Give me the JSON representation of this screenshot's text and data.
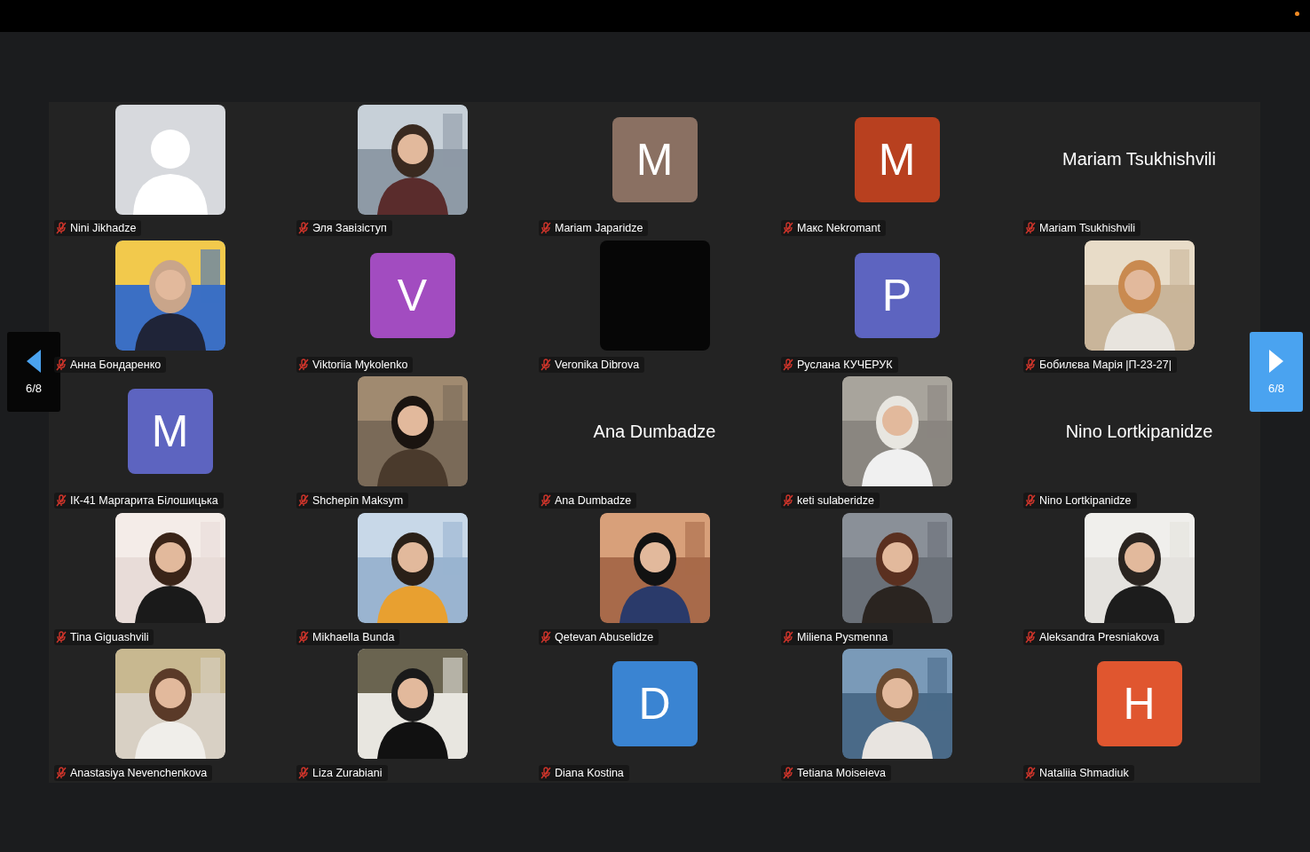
{
  "pager": {
    "previous": "6/8",
    "next": "6/8"
  },
  "participants": [
    {
      "name": "Nini Jikhadze",
      "muted": true,
      "tile": {
        "kind": "silhouette"
      }
    },
    {
      "name": "Эля Завізіступ",
      "muted": true
    },
    {
      "name": "Mariam Japaridze",
      "muted": true,
      "tile": {
        "kind": "initial",
        "letter": "M",
        "color": "#8a7062"
      }
    },
    {
      "name": "Макс Nekromant",
      "muted": true,
      "tile": {
        "kind": "initial",
        "letter": "M",
        "color": "#b8401f"
      }
    },
    {
      "name": "Mariam Tsukhishvili",
      "muted": true,
      "tile": {
        "kind": "name",
        "text": "Mariam Tsukhishvili"
      }
    },
    {
      "name": "Анна Бондаренко",
      "muted": true
    },
    {
      "name": "Viktoriia Mykolenko",
      "muted": true,
      "tile": {
        "kind": "initial",
        "letter": "V",
        "color": "#a24cc0"
      }
    },
    {
      "name": "Veronika Dibrova",
      "muted": true,
      "tile": {
        "kind": "blank"
      }
    },
    {
      "name": "Руслана КУЧЕРУК",
      "muted": true,
      "tile": {
        "kind": "initial",
        "letter": "P",
        "color": "#5d64c0"
      }
    },
    {
      "name": "Бобилєва Марія |П-23-27|",
      "muted": true
    },
    {
      "name": "ІК-41 Маргарита Білошицька",
      "muted": true,
      "tile": {
        "kind": "initial",
        "letter": "M",
        "color": "#5d64c0"
      }
    },
    {
      "name": "Shchepin Maksym",
      "muted": true
    },
    {
      "name": "Ana Dumbadze",
      "muted": true,
      "tile": {
        "kind": "name",
        "text": "Ana Dumbadze"
      }
    },
    {
      "name": "keti sulaberidze",
      "muted": true
    },
    {
      "name": "Nino Lortkipanidze",
      "muted": true,
      "tile": {
        "kind": "name",
        "text": "Nino Lortkipanidze"
      }
    },
    {
      "name": "Tina Giguashvili",
      "muted": true
    },
    {
      "name": "Mikhaella Bunda",
      "muted": true
    },
    {
      "name": "Qetevan Abuselidze",
      "muted": true
    },
    {
      "name": "Miliena Pysmenna",
      "muted": true
    },
    {
      "name": "Aleksandra Presniakova",
      "muted": true
    },
    {
      "name": "Anastasiya Nevenchenkova",
      "muted": true
    },
    {
      "name": "Liza Zurabiani",
      "muted": true
    },
    {
      "name": "Diana Kostina",
      "muted": true,
      "tile": {
        "kind": "initial",
        "letter": "D",
        "color": "#3a84d2"
      }
    },
    {
      "name": "Tetiana Moiseieva",
      "muted": true
    },
    {
      "name": "Nataliia Shmadiuk",
      "muted": true,
      "tile": {
        "kind": "initial",
        "letter": "H",
        "color": "#e0562f"
      }
    }
  ]
}
